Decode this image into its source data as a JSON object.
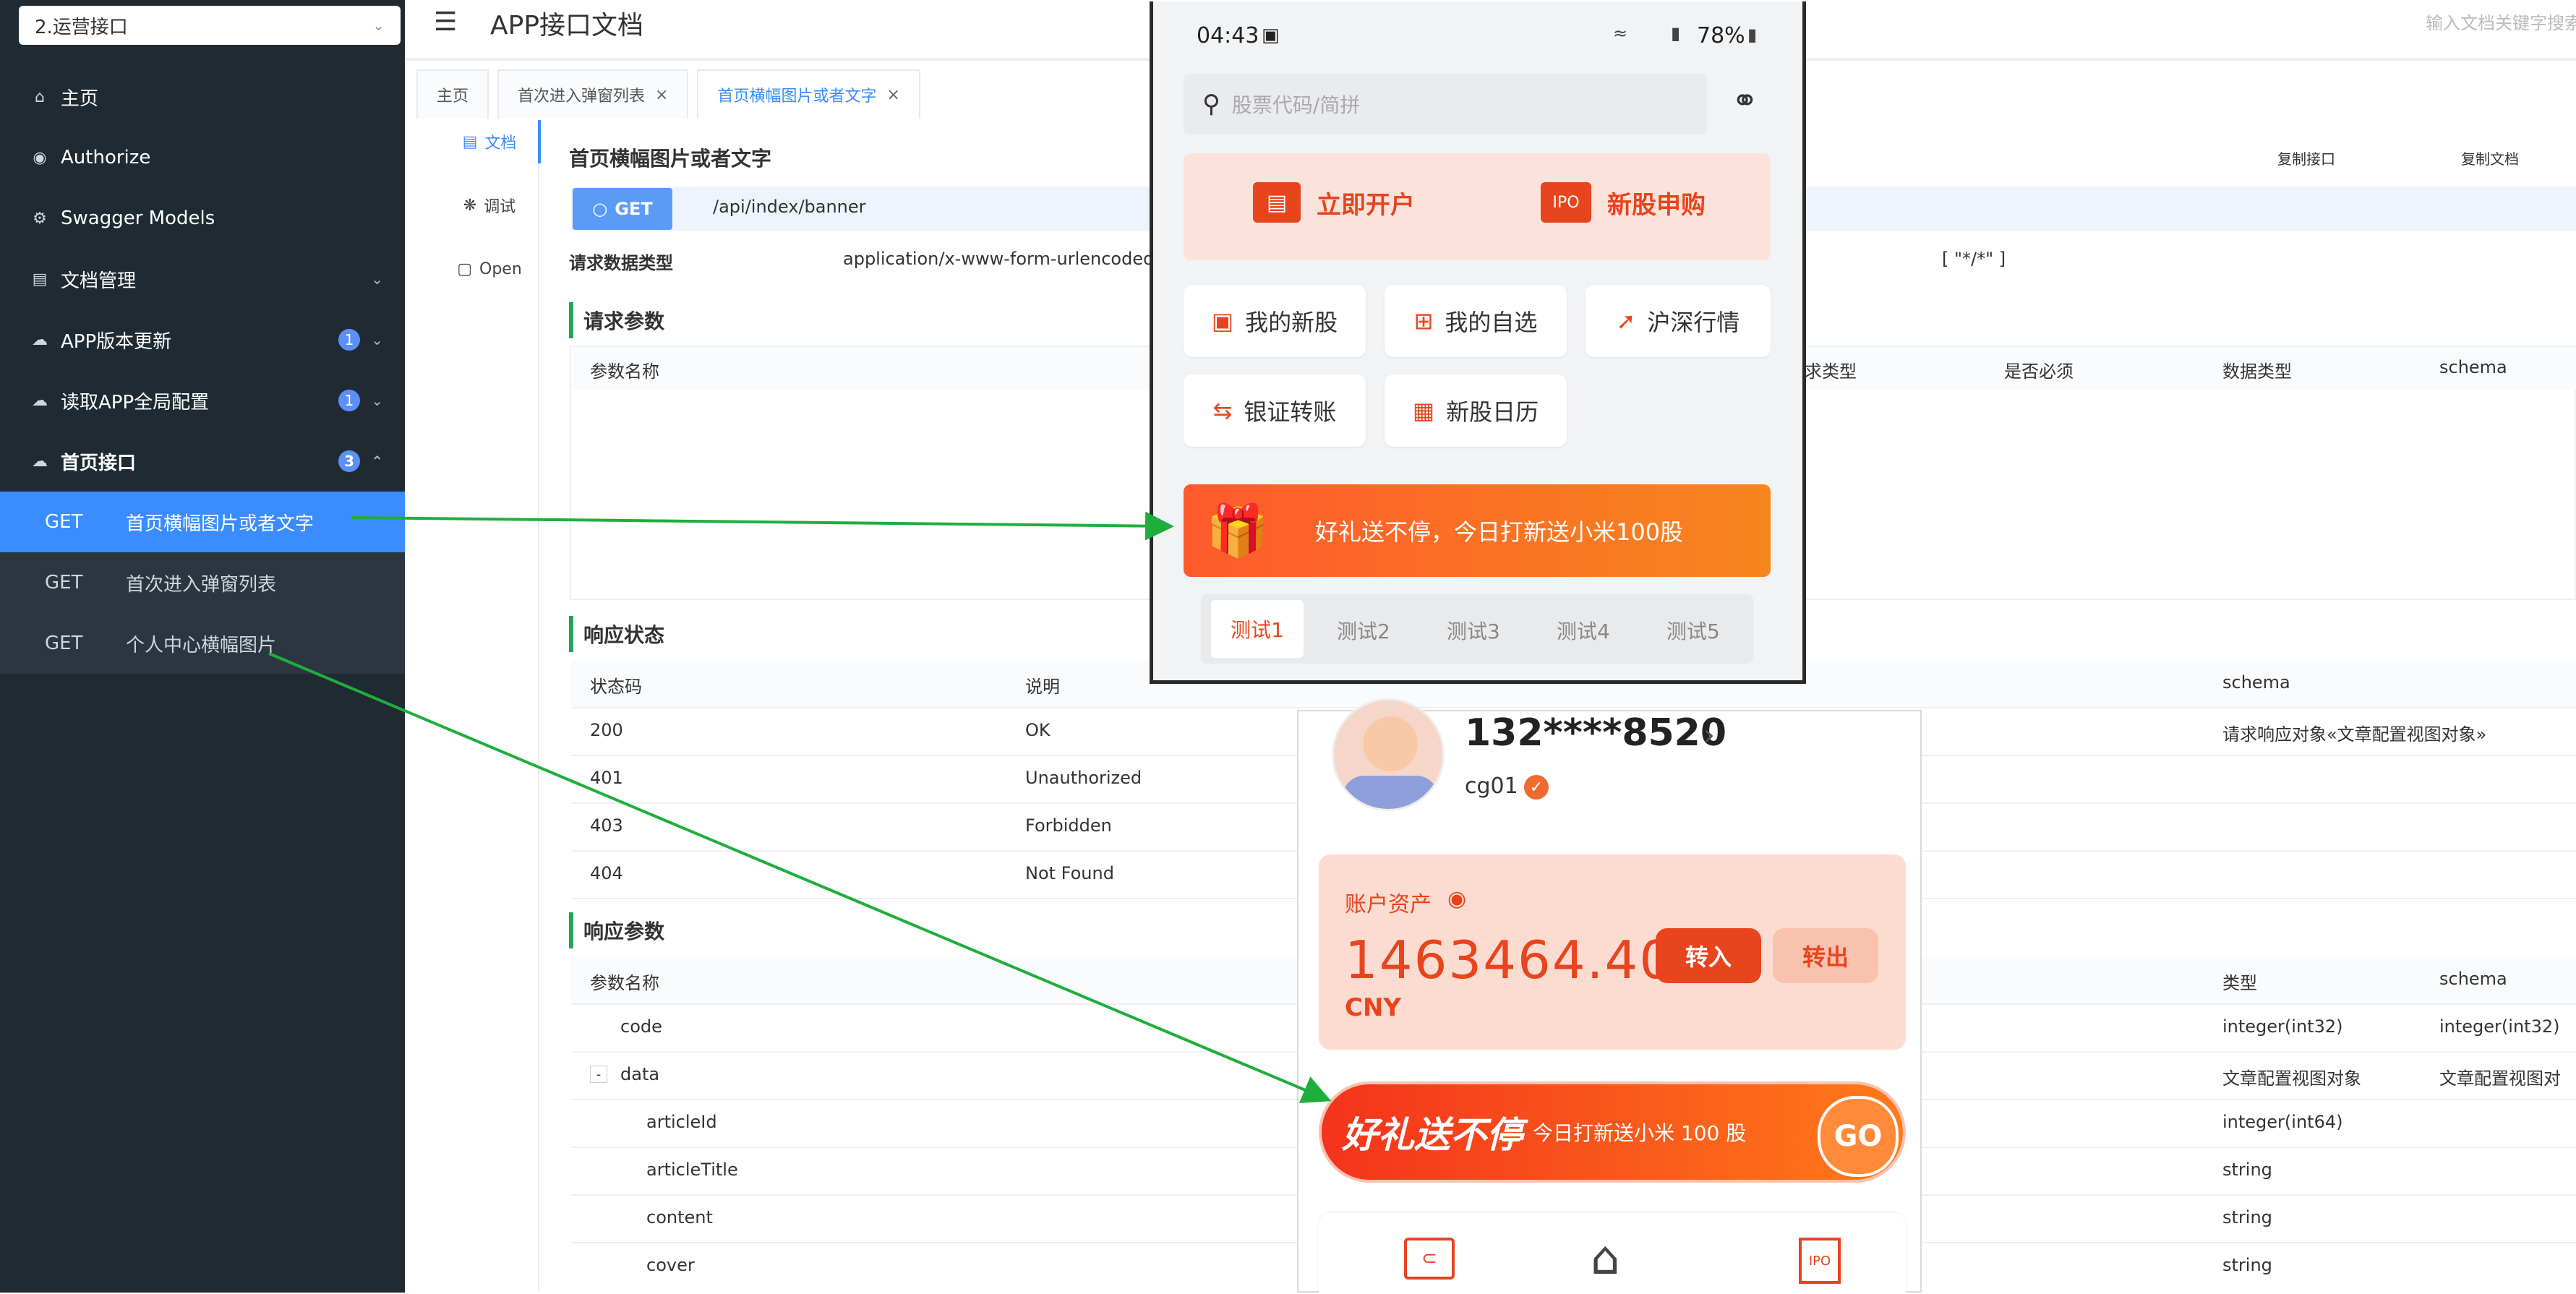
{
  "sidebar": {
    "group_select": "2.运营接口",
    "items": [
      {
        "label": "主页"
      },
      {
        "label": "Authorize"
      },
      {
        "label": "Swagger Models"
      },
      {
        "label": "文档管理"
      },
      {
        "label": "APP版本更新",
        "badge": "1"
      },
      {
        "label": "读取APP全局配置",
        "badge": "1"
      },
      {
        "label": "首页接口",
        "badge": "3"
      }
    ],
    "sub_items": [
      {
        "method": "GET",
        "label": "首页横幅图片或者文字"
      },
      {
        "method": "GET",
        "label": "首次进入弹窗列表"
      },
      {
        "method": "GET",
        "label": "个人中心横幅图片"
      }
    ]
  },
  "header": {
    "title": "APP接口文档",
    "search_placeholder": "输入文档关键字搜索"
  },
  "tabs": [
    {
      "label": "主页"
    },
    {
      "label": "首次进入弹窗列表"
    },
    {
      "label": "首页横幅图片或者文字"
    }
  ],
  "vnav": [
    {
      "label": "文档"
    },
    {
      "label": "调试"
    },
    {
      "label": "Open"
    }
  ],
  "doc": {
    "title": "首页横幅图片或者文字",
    "copy_api": "复制接口",
    "copy_doc": "复制文档",
    "method": "GET",
    "path": "/api/index/banner",
    "req_type_label": "请求数据类型",
    "req_type_value": "application/x-www-form-urlencoded",
    "resp_type_value": "[ \"*/*\" ]",
    "req_params_title": "请求参数",
    "req_params_headers": [
      "参数名称",
      "求类型",
      "是否必须",
      "数据类型",
      "schema"
    ],
    "resp_status_title": "响应状态",
    "resp_status_headers": [
      "状态码",
      "说明",
      "schema"
    ],
    "resp_status_rows": [
      {
        "code": "200",
        "desc": "OK",
        "schema": "请求响应对象«文章配置视图对象»"
      },
      {
        "code": "401",
        "desc": "Unauthorized",
        "schema": ""
      },
      {
        "code": "403",
        "desc": "Forbidden",
        "schema": ""
      },
      {
        "code": "404",
        "desc": "Not Found",
        "schema": ""
      }
    ],
    "resp_params_title": "响应参数",
    "resp_params_headers": [
      "参数名称",
      "类型",
      "schema"
    ],
    "resp_params_rows": [
      {
        "name": "code",
        "type": "integer(int32)",
        "schema": "integer(int32)"
      },
      {
        "toggle": "-",
        "name": "data",
        "type": "文章配置视图对象",
        "schema": "文章配置视图对"
      },
      {
        "name": "articleId",
        "type": "integer(int64)",
        "schema": ""
      },
      {
        "name": "articleTitle",
        "type": "string",
        "schema": ""
      },
      {
        "name": "content",
        "type": "string",
        "schema": ""
      },
      {
        "name": "cover",
        "type": "string",
        "schema": ""
      }
    ]
  },
  "phone1": {
    "time": "04:43",
    "status_right": "78%",
    "search_placeholder": "股票代码/简拼",
    "btn_open": "立即开户",
    "btn_ipo": "新股申购",
    "ipo_tag": "IPO",
    "grid": [
      "我的新股",
      "我的自选",
      "沪深行情",
      "银证转账",
      "新股日历"
    ],
    "banner_text": "好礼送不停，今日打新送小米100股",
    "tabs": [
      "测试1",
      "测试2",
      "测试3",
      "测试4",
      "测试5"
    ]
  },
  "phone2": {
    "phone": "132****8520",
    "username": "cg01",
    "assets_label": "账户资产",
    "amount": "1463464.40",
    "currency": "CNY",
    "btn_in": "转入",
    "btn_out": "转出",
    "banner_big": "好礼送不停",
    "banner_small": "今日打新送小米 100 股",
    "banner_go": "GO",
    "nav_ipo": "IPO"
  },
  "colors": {
    "sidebar_bg": "#1f2a33",
    "accent_blue": "#3b8cff",
    "section_green": "#23a455",
    "arrow_green": "#1fae3c",
    "brand_red": "#e8441e"
  }
}
